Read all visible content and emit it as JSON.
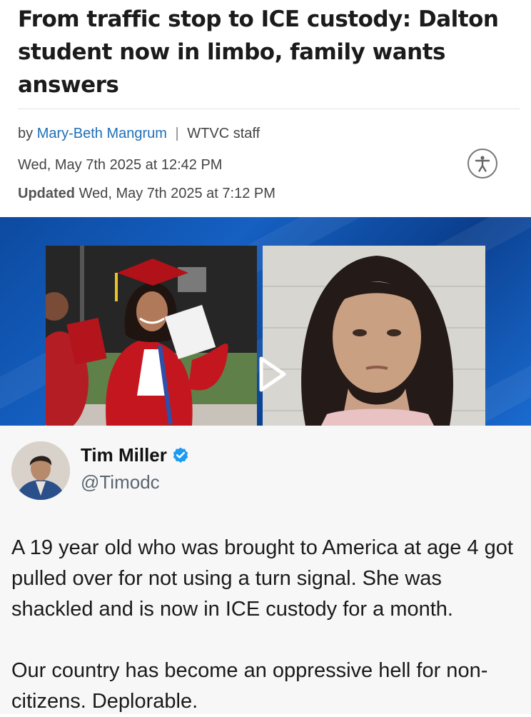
{
  "article": {
    "headline": "From traffic stop to ICE custody: Dalton student now in limbo, family wants answers",
    "by_prefix": "by",
    "author": "Mary-Beth Mangrum",
    "separator": "|",
    "outlet": "WTVC staff",
    "published": "Wed, May 7th 2025 at 12:42 PM",
    "updated_label": "Updated",
    "updated": "Wed, May 7th 2025 at 7:12 PM",
    "accessibility_icon": "accessibility-icon",
    "video_icon": "play-icon"
  },
  "tweet": {
    "name": "Tim Miller",
    "verified_icon": "verified-badge-icon",
    "handle": "@Timodc",
    "paragraph1": "A 19 year old who was brought to America at age 4 got pulled over for not using a turn signal. She was shackled and is now in ICE custody for a month.",
    "paragraph2": "Our country has become an oppressive hell for non-citizens. Deplorable."
  },
  "colors": {
    "author_link": "#1d6fb8",
    "media_background": "#1560c2",
    "verified_badge": "#1d9bf0"
  }
}
